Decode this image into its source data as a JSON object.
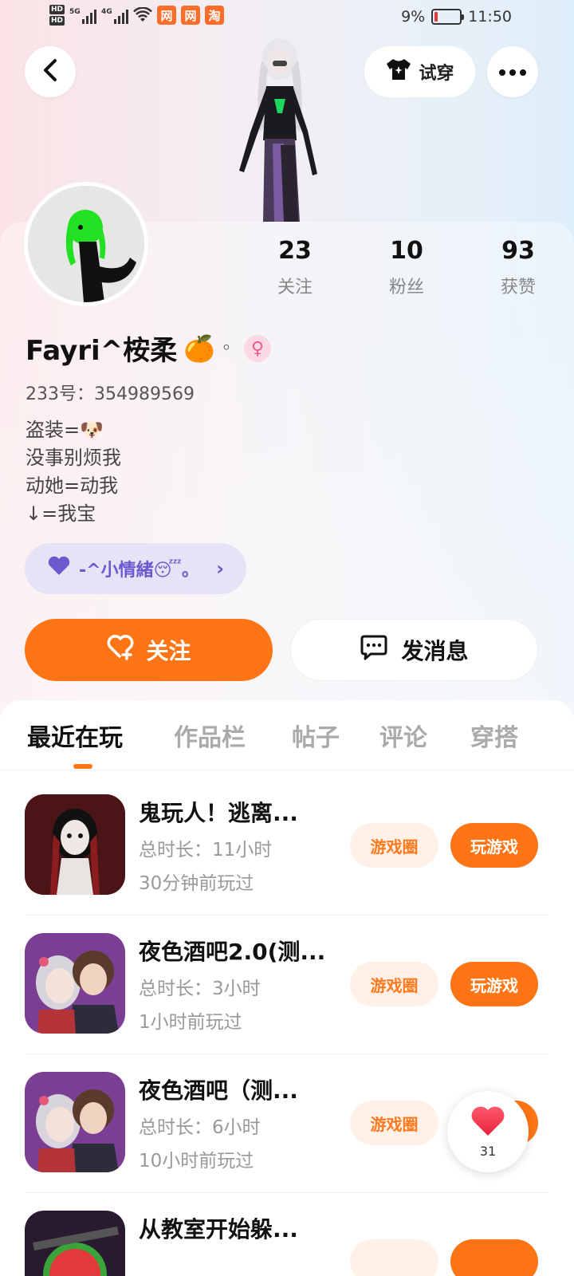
{
  "status_bar": {
    "hd1": "HD",
    "hd2": "HD",
    "signal1": "5G",
    "signal2": "4G",
    "app_icon_1": "网",
    "app_icon_2": "网",
    "app_icon_3": "淘",
    "battery": "9%",
    "time": "11:50"
  },
  "header": {
    "try_on_label": "试穿"
  },
  "profile": {
    "stats": [
      {
        "value": "23",
        "label": "关注"
      },
      {
        "value": "10",
        "label": "粉丝"
      },
      {
        "value": "93",
        "label": "获赞"
      }
    ],
    "nickname": "Fayri^桉柔",
    "nickname_emoji": "🍊",
    "nickname_suffix": "◦",
    "gender": "♀",
    "uid": "233号：354989569",
    "bio_lines": [
      "盗装=🐶",
      "没事别烦我",
      "动她=动我",
      "↓=我宝"
    ],
    "mood_label": "-^小情緒😴。",
    "mood_chevron": "›"
  },
  "actions": {
    "follow_label": "关注",
    "message_label": "发消息"
  },
  "tabs": [
    "最近在玩",
    "作品栏",
    "帖子",
    "评论",
    "穿搭"
  ],
  "games": [
    {
      "title": "鬼玩人！逃离...",
      "duration": "总时长：11小时",
      "last_played": "30分钟前玩过",
      "circle_label": "游戏圈",
      "play_label": "玩游戏"
    },
    {
      "title": "夜色酒吧2.0(测...",
      "duration": "总时长：3小时",
      "last_played": "1小时前玩过",
      "circle_label": "游戏圈",
      "play_label": "玩游戏"
    },
    {
      "title": "夜色酒吧（测...",
      "duration": "总时长：6小时",
      "last_played": "10小时前玩过",
      "circle_label": "游戏圈",
      "play_label": "玩游戏"
    },
    {
      "title": "从教室开始躲...",
      "duration": "",
      "last_played": "",
      "circle_label": "",
      "play_label": ""
    }
  ],
  "like_float": {
    "count": "31"
  },
  "colors": {
    "accent": "#ff7516",
    "mood_chip": "#e6e3f6"
  }
}
